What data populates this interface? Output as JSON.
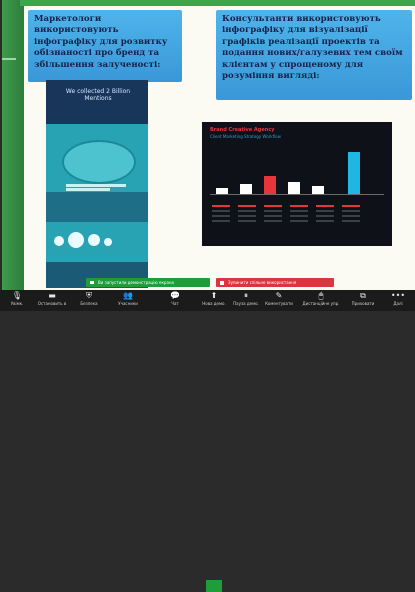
{
  "slide": {
    "left_title": "Маркетологи використовують інфографіку для розвитку обізнаності про бренд та збільшення залученості:",
    "right_title": "Консультанти використовують інфографіку для візуалізації графіків реалізації проектів та подання нових/галузевих тем своїм клієнтам у спрощеному для розуміння вигляді:",
    "infographic": {
      "headline": "We collected 2 Billion Mentions"
    },
    "dashboard": {
      "brand": "Brand Creative Agency",
      "subtitle": "Client Marketing Strategy Workflow"
    }
  },
  "share_banner": "Ви запустили демонстрацію екрана",
  "stop_banner": "Зупинити спільне використання",
  "toolbar": {
    "items": [
      {
        "label": "Увімк.",
        "icon": "microphone-icon"
      },
      {
        "label": "Оста­новить в",
        "icon": "video-icon"
      },
      {
        "label": "Безпека",
        "icon": "shield-icon"
      },
      {
        "label": "Учасники",
        "icon": "participants-icon"
      },
      {
        "label": "Чат",
        "icon": "chat-icon"
      },
      {
        "label": "Нова демо.",
        "icon": "share-screen-icon"
      },
      {
        "label": "Пауза демо.",
        "icon": "pause-icon"
      },
      {
        "label": "Коментувати",
        "icon": "annotate-icon"
      },
      {
        "label": "Дистанційне упр.",
        "icon": "remote-control-icon"
      },
      {
        "label": "Приховати",
        "icon": "hide-icon"
      },
      {
        "label": "Далі",
        "icon": "more-icon"
      }
    ]
  }
}
